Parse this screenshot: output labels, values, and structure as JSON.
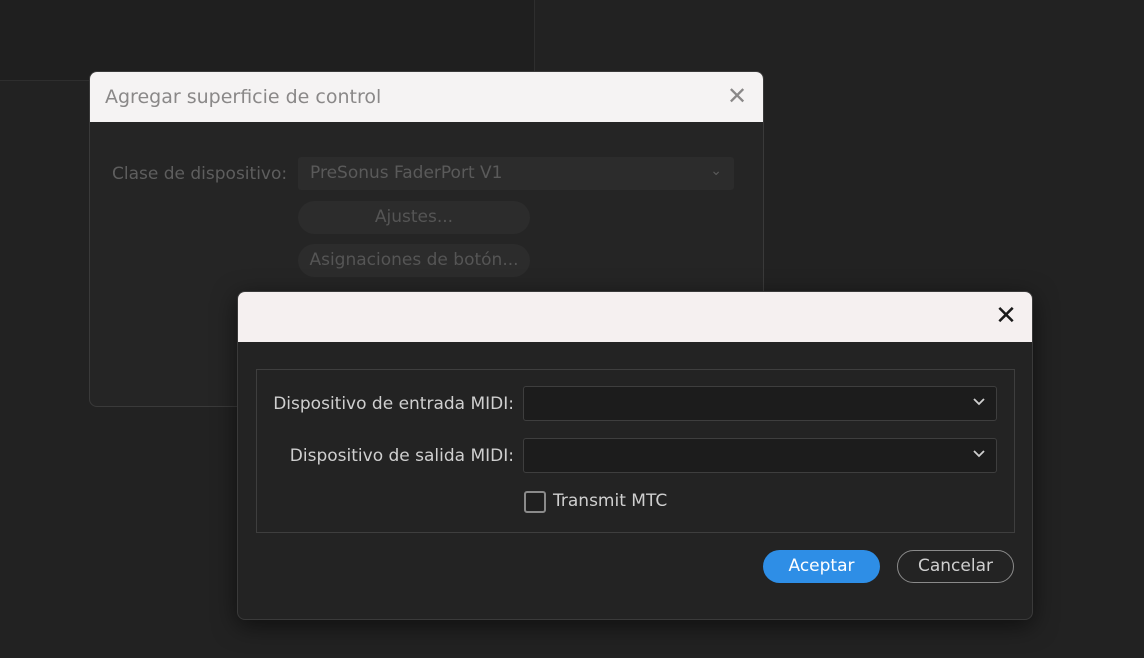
{
  "back_dialog": {
    "title": "Agregar superficie de control",
    "close_glyph": "✕",
    "device_class_label": "Clase de dispositivo:",
    "device_class_value": "PreSonus FaderPort V1",
    "settings_button": "Ajustes...",
    "button_assignments_button": "Asignaciones de botón..."
  },
  "front_dialog": {
    "title": "",
    "close_glyph": "✕",
    "midi_input_label": "Dispositivo de entrada MIDI:",
    "midi_input_value": "",
    "midi_output_label": "Dispositivo de salida MIDI:",
    "midi_output_value": "",
    "transmit_mtc_label": "Transmit MTC",
    "transmit_mtc_checked": false,
    "ok_button": "Aceptar",
    "cancel_button": "Cancelar"
  },
  "colors": {
    "accent": "#2e8ee6",
    "background": "#222222",
    "titlebar": "#f5f0f0"
  }
}
